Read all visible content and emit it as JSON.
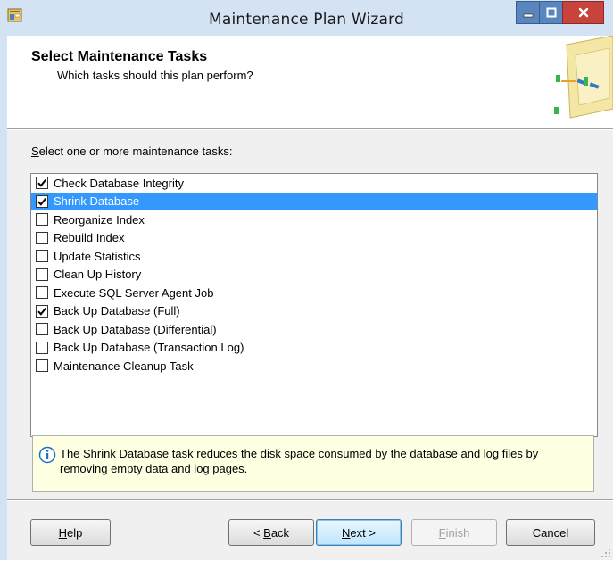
{
  "window": {
    "title": "Maintenance Plan Wizard",
    "icon": "wizard-app-icon"
  },
  "caption_buttons": {
    "minimize_icon": "minimize-icon",
    "maximize_icon": "maximize-icon",
    "close_icon": "close-icon"
  },
  "header": {
    "title": "Select Maintenance Tasks",
    "subtitle": "Which tasks should this plan perform?",
    "graphic_icon": "wizard-graphic-icon"
  },
  "prompt": {
    "mnemonic": "S",
    "rest": "elect one or more maintenance tasks:"
  },
  "tasks": [
    {
      "label": "Check Database Integrity",
      "checked": true,
      "selected": false
    },
    {
      "label": "Shrink Database",
      "checked": true,
      "selected": true
    },
    {
      "label": "Reorganize Index",
      "checked": false,
      "selected": false
    },
    {
      "label": "Rebuild Index",
      "checked": false,
      "selected": false
    },
    {
      "label": "Update Statistics",
      "checked": false,
      "selected": false
    },
    {
      "label": "Clean Up History",
      "checked": false,
      "selected": false
    },
    {
      "label": "Execute SQL Server Agent Job",
      "checked": false,
      "selected": false
    },
    {
      "label": "Back Up Database (Full)",
      "checked": true,
      "selected": false
    },
    {
      "label": "Back Up Database (Differential)",
      "checked": false,
      "selected": false
    },
    {
      "label": "Back Up Database (Transaction Log)",
      "checked": false,
      "selected": false
    },
    {
      "label": "Maintenance Cleanup Task",
      "checked": false,
      "selected": false
    }
  ],
  "info": {
    "icon": "info-icon",
    "text": "The Shrink Database task reduces the disk space consumed by the database and log files by removing empty data and log pages."
  },
  "buttons": {
    "help": {
      "mnemonic": "H",
      "rest": "elp"
    },
    "back": {
      "prefix": "< ",
      "mnemonic": "B",
      "rest": "ack"
    },
    "next": {
      "mnemonic": "N",
      "rest": "ext >"
    },
    "finish": {
      "mnemonic": "F",
      "rest": "inish"
    },
    "cancel": {
      "label": "Cancel"
    }
  },
  "colors": {
    "selection": "#3399ff",
    "info_background": "#ffffe1",
    "close_button": "#c7433b"
  }
}
